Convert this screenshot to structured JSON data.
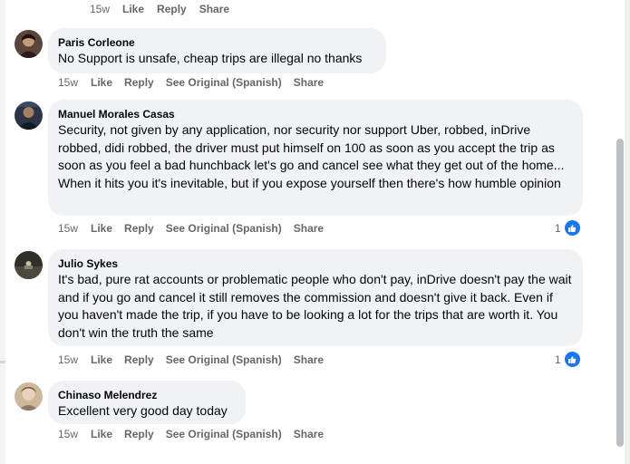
{
  "top_actions": {
    "time": "15w",
    "like": "Like",
    "reply": "Reply",
    "share": "Share"
  },
  "comments": [
    {
      "author": "Paris Corleone",
      "text": "No Support is unsafe, cheap trips are illegal no thanks",
      "time": "15w",
      "like": "Like",
      "reply": "Reply",
      "see_original": "See Original (Spanish)",
      "share": "Share",
      "avatar_color": "#3a2a22"
    },
    {
      "author": "Manuel Morales Casas",
      "text": "Security, not given by any application, nor security nor support Uber, robbed, inDrive robbed, didi robbed, the driver must put himself on 100 as soon as you accept the trip as soon as you feel a bad hunchback let's go and cancel see what they get out of the home... When it hits you it's inevitable, but if you expose yourself then there's how humble opinion",
      "time": "15w",
      "like": "Like",
      "reply": "Reply",
      "see_original": "See Original (Spanish)",
      "share": "Share",
      "reaction_count": "1",
      "avatar_color": "#1f2a3a"
    },
    {
      "author": "Julio Sykes",
      "text": "It's bad, pure rat accounts or problematic people who don't pay, inDrive doesn't pay the wait and if you go and cancel it still removes the commission and doesn't give it back. Even if you haven't made the trip, if you have to be looking a lot for the trips that are worth it. You don't win the truth the same",
      "time": "15w",
      "like": "Like",
      "reply": "Reply",
      "see_original": "See Original (Spanish)",
      "share": "Share",
      "reaction_count": "1",
      "avatar_color": "#2b2e24"
    },
    {
      "author": "Chinaso Melendrez",
      "text": "Excellent very good day today",
      "time": "15w",
      "like": "Like",
      "reply": "Reply",
      "see_original": "See Original (Spanish)",
      "share": "Share",
      "avatar_color": "#b39a7c"
    }
  ],
  "colors": {
    "bubble": "#f0f2f5",
    "meta": "#65676b",
    "like_blue": "#1877f2"
  },
  "icons": {
    "reaction": "thumbs-up-icon"
  }
}
